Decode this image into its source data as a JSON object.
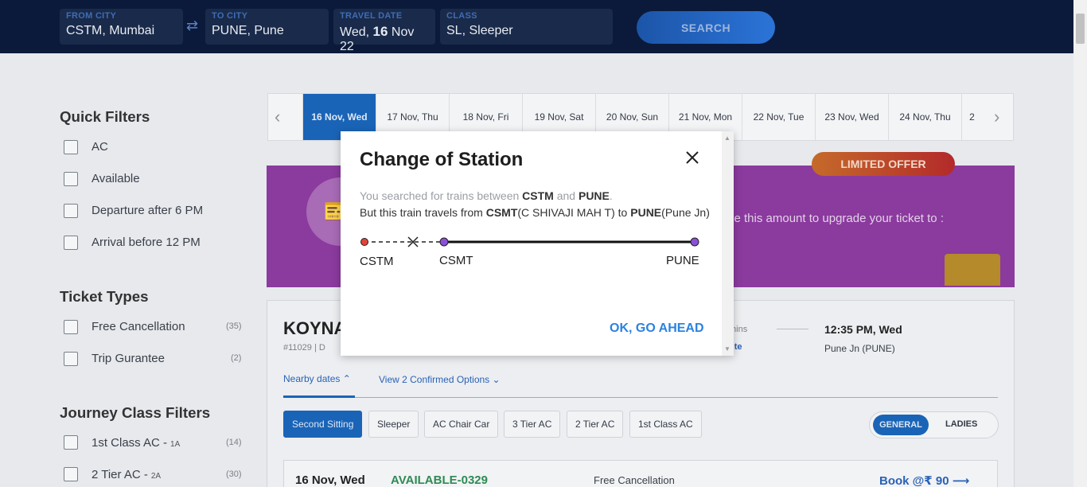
{
  "search": {
    "from_label": "FROM CITY",
    "from_value": "CSTM, Mumbai",
    "to_label": "TO CITY",
    "to_value": "PUNE, Pune",
    "date_label": "TRAVEL DATE",
    "date_prefix": "Wed,",
    "date_day": "16",
    "date_suffix": "Nov 22",
    "class_label": "CLASS",
    "class_value": "SL, Sleeper",
    "swap_icon": "⇄",
    "search_button": "SEARCH"
  },
  "filters": {
    "quick_title": "Quick Filters",
    "quick": [
      "AC",
      "Available",
      "Departure after 6 PM",
      "Arrival before 12 PM"
    ],
    "ticket_title": "Ticket Types",
    "ticket": [
      {
        "label": "Free Cancellation",
        "count": "(35)"
      },
      {
        "label": "Trip Gurantee",
        "count": "(2)"
      }
    ],
    "class_title": "Journey Class Filters",
    "classes": [
      {
        "label": "1st Class AC -",
        "code": "1A",
        "count": "(14)"
      },
      {
        "label": "2 Tier AC -",
        "code": "2A",
        "count": "(30)"
      }
    ]
  },
  "dates": [
    "16 Nov, Wed",
    "17 Nov, Thu",
    "18 Nov, Fri",
    "19 Nov, Sat",
    "20 Nov, Sun",
    "21 Nov, Mon",
    "22 Nov, Tue",
    "23 Nov, Wed",
    "24 Nov, Thu",
    "2"
  ],
  "promo": {
    "badge": "LIMITED OFFER",
    "text": "se this amount to upgrade your ticket to :"
  },
  "train": {
    "name": "KOYNA",
    "number": "#11029  |  D",
    "duration": "mins",
    "route": "ute",
    "arrival_time": "12:35 PM, Wed",
    "arrival_station": "Pune Jn (PUNE)",
    "nearby": "Nearby dates",
    "confirmed": "View 2 Confirmed Options",
    "classes": [
      "Second Sitting",
      "Sleeper",
      "AC Chair Car",
      "3 Tier AC",
      "2 Tier AC",
      "1st Class AC"
    ],
    "quota_general": "GENERAL",
    "quota_ladies": "LADIES",
    "avail_date": "16 Nov, Wed",
    "avail_status": "AVAILABLE-0329",
    "free_cancel": "Free Cancellation",
    "book": "Book @₹ 90 ⟶"
  },
  "modal": {
    "title": "Change of Station",
    "line1_a": "You searched for trains between ",
    "line1_from": "CSTM",
    "line1_and": " and ",
    "line1_to": "PUNE",
    "line1_end": ".",
    "line2_a": "But this train travels from ",
    "line2_from": "CSMT",
    "line2_from_name": "(C SHIVAJI MAH T)",
    "line2_to_word": " to ",
    "line2_to": "PUNE",
    "line2_to_name": "(Pune Jn)",
    "stop_searched": "CSTM",
    "stop_actual": "CSMT",
    "stop_dest": "PUNE",
    "ok_button": "OK, GO AHEAD"
  },
  "colors": {
    "header_bg": "#0b1a3a",
    "accent_blue": "#1a64b7",
    "link_blue": "#2b82e0",
    "dot_red": "#e0443a",
    "dot_purple": "#8c4fd8",
    "available_green": "#2f8a55"
  }
}
